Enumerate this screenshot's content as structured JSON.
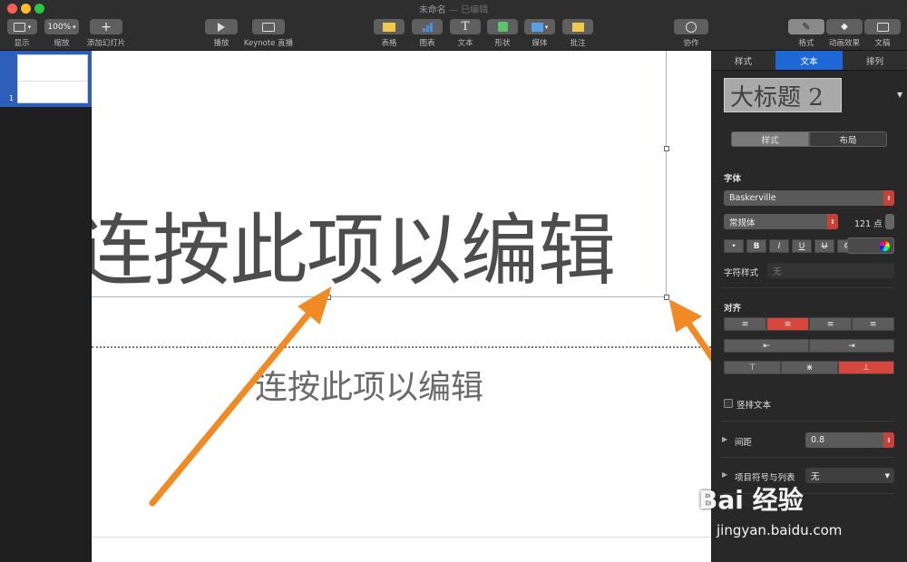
{
  "window": {
    "title": "未命名",
    "subtitle": " — 已编辑"
  },
  "toolbar": {
    "view_label": "显示",
    "zoom_value": "100%",
    "zoom_label": "缩放",
    "add_slide_label": "添加幻灯片",
    "play_label": "播放",
    "keynote_live_label": "Keynote 直播",
    "table_label": "表格",
    "chart_label": "图表",
    "text_label": "文本",
    "shape_label": "形状",
    "media_label": "媒体",
    "comment_label": "批注",
    "collaborate_label": "协作",
    "format_label": "格式",
    "animate_label": "动画效果",
    "document_label": "文稿",
    "text_icon_glyph": "T",
    "plus_glyph": "+"
  },
  "navigator": {
    "slide_number": "1"
  },
  "slide": {
    "title_placeholder": "连按此项以编辑",
    "body_placeholder": "连按此项以编辑"
  },
  "inspector": {
    "tabs": [
      "样式",
      "文本",
      "排列"
    ],
    "active_tab": "文本",
    "paragraph_style": "大标题 2",
    "sub_tabs": [
      "样式",
      "布局"
    ],
    "font_section": "字体",
    "font_name": "Baskerville",
    "font_style": "常规体",
    "font_size": "121 点",
    "bullet_glyph": "•",
    "bold": "B",
    "italic": "I",
    "underline": "U",
    "strike": "U",
    "char_style_label": "字符样式",
    "char_style_value": "无",
    "align_section": "对齐",
    "vertical_text_label": "竖排文本",
    "spacing_label": "间距",
    "spacing_value": "0.8",
    "bullets_label": "项目符号与列表",
    "bullets_value": "无"
  },
  "colors": {
    "accent": "#1d67d6",
    "active_align": "#d8473d"
  },
  "watermark": {
    "brand": "Bai 经验",
    "url": "jingyan.baidu.com"
  }
}
